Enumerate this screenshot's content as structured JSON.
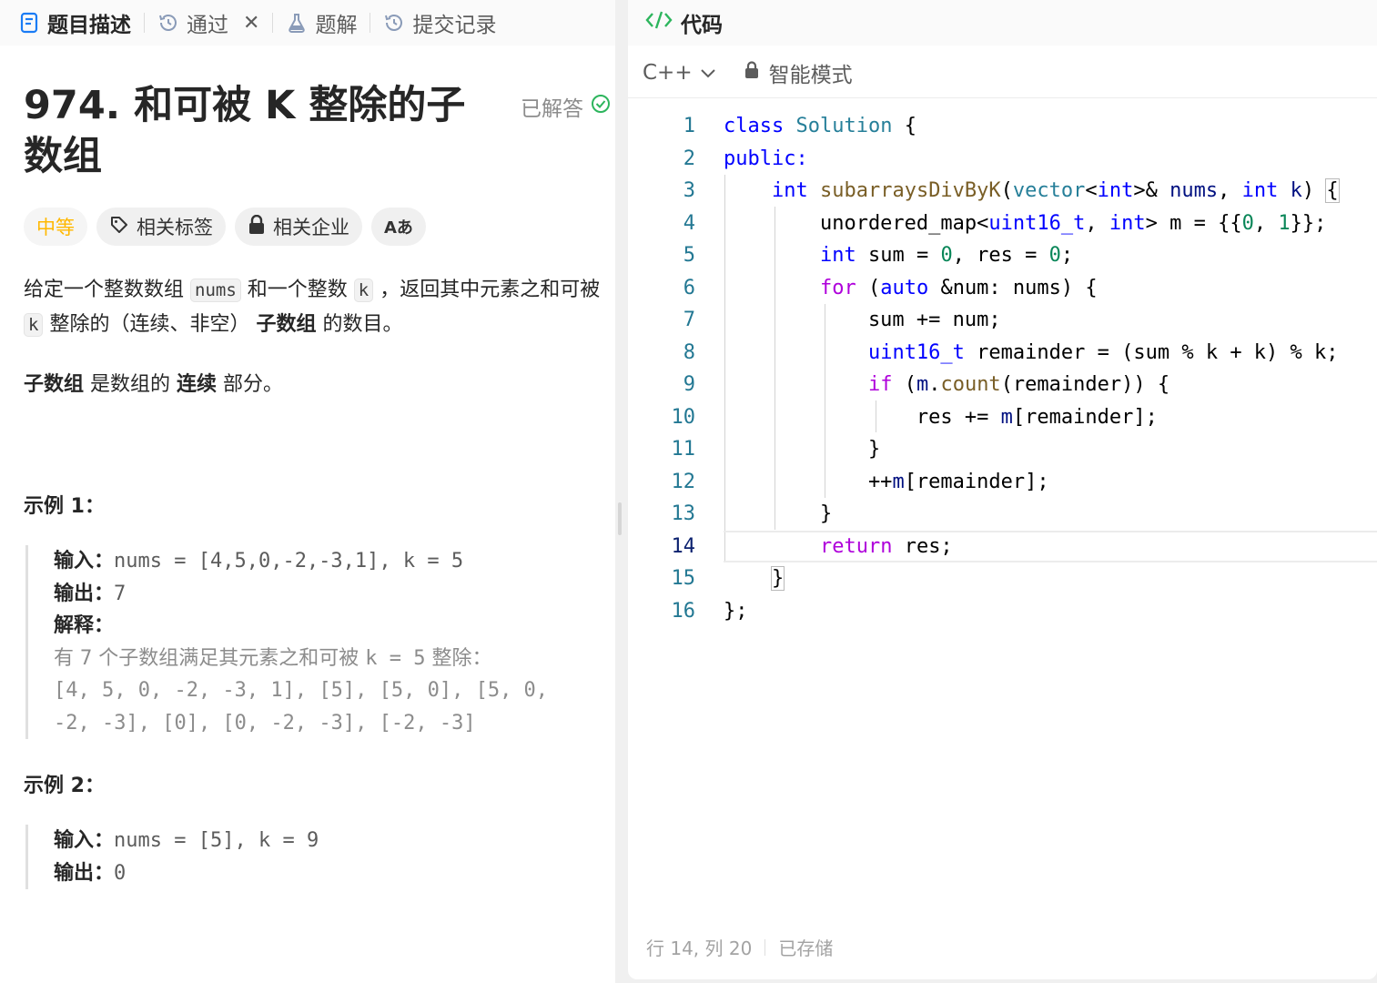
{
  "left_tabs": {
    "description": "题目描述",
    "accepted": "通过",
    "solutions": "题解",
    "submissions": "提交记录"
  },
  "problem": {
    "title": "974. 和可被 K 整除的子数组",
    "solved_label": "已解答",
    "difficulty": "中等",
    "tags_label": "相关标签",
    "companies_label": "相关企业",
    "translate_label": "Aあ",
    "desc_p1_a": "给定一个整数数组 ",
    "desc_code_nums": "nums",
    "desc_p1_b": " 和一个整数 ",
    "desc_code_k1": "k",
    "desc_p1_c": " ，返回其中元素之和可被 ",
    "desc_code_k2": "k",
    "desc_p1_d": " 整除的（连续、非空） ",
    "desc_p1_bold": "子数组",
    "desc_p1_e": " 的数目。",
    "desc_p2_bold1": "子数组",
    "desc_p2_a": " 是数组的 ",
    "desc_p2_bold2": "连续",
    "desc_p2_b": " 部分。"
  },
  "example1": {
    "title": "示例 1：",
    "input_label": "输入：",
    "input_value": "nums = [4,5,0,-2,-3,1], k = 5",
    "output_label": "输出：",
    "output_value": "7",
    "explain_label": "解释：",
    "explain_a": "有 ",
    "explain_n": "7",
    "explain_b": " 个子数组满足其元素之和可被 ",
    "explain_k": "k = 5",
    "explain_c": " 整除：",
    "explain_line2": "[4, 5, 0, -2, -3, 1], [5], [5, 0], [5, 0,",
    "explain_line3": "-2, -3], [0], [0, -2, -3], [-2, -3]"
  },
  "example2": {
    "title": "示例 2：",
    "input_label": "输入：",
    "input_value": "nums = [5], k = 9",
    "output_label": "输出：",
    "output_value": "0"
  },
  "code_panel": {
    "title": "代码",
    "language": "C++",
    "mode": "智能模式",
    "status_position": "行 14, 列 20",
    "status_saved": "已存储"
  },
  "code_lines": [
    {
      "n": "1"
    },
    {
      "n": "2"
    },
    {
      "n": "3"
    },
    {
      "n": "4"
    },
    {
      "n": "5"
    },
    {
      "n": "6"
    },
    {
      "n": "7"
    },
    {
      "n": "8"
    },
    {
      "n": "9"
    },
    {
      "n": "10"
    },
    {
      "n": "11"
    },
    {
      "n": "12"
    },
    {
      "n": "13"
    },
    {
      "n": "14"
    },
    {
      "n": "15"
    },
    {
      "n": "16"
    }
  ],
  "colors": {
    "keyword": "#0000ff",
    "control": "#af00db",
    "type": "#267f99",
    "function": "#795e26",
    "number": "#098658",
    "difficulty_medium": "#ffb800",
    "solved_check": "#2db55d"
  }
}
